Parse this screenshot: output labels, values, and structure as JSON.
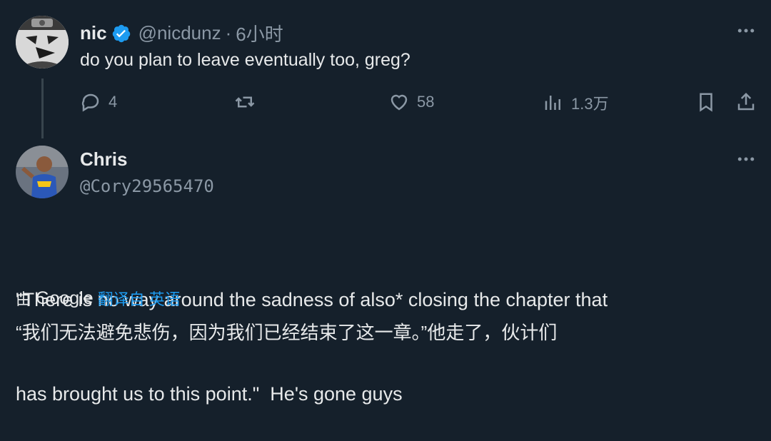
{
  "tweet1": {
    "name": "nic",
    "handle": "@nicdunz",
    "separator": "·",
    "time": "6小时",
    "text": "do you plan to leave eventually too, greg?",
    "actions": {
      "reply_count": "4",
      "retweet_count": "",
      "like_count": "58",
      "views_count": "1.3万"
    },
    "verified": true
  },
  "tweet2": {
    "name": "Chris",
    "handle": "@Cory29565470",
    "text_line1": "\"There is no way around the sadness of also* closing the chapter that",
    "text_line2": "has brought us to this point.\"  He's gone guys",
    "translation": {
      "by": "由",
      "provider": "Google",
      "action": "翻译自 英语",
      "translated": "“我们无法避免悲伤，因为我们已经结束了这一章。”他走了，伙计们"
    }
  },
  "icons": {
    "more": "more-dots-icon",
    "reply": "reply-icon",
    "retweet": "retweet-icon",
    "like": "like-icon",
    "views": "views-icon",
    "bookmark": "bookmark-icon",
    "share": "share-icon",
    "verified": "verified-badge-icon"
  },
  "colors": {
    "background": "#15202b",
    "text": "#e7e9ea",
    "muted": "#8b98a5",
    "accent": "#1d9bf0"
  }
}
